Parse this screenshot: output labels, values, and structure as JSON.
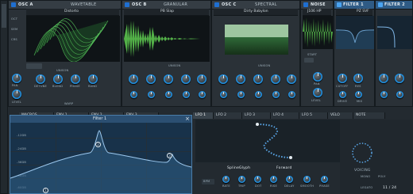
{
  "colors": {
    "accent": "#1f8fe0",
    "wave": "#6cd06a",
    "bg": "#1b2126",
    "curve": "#7fb6e6"
  },
  "left_strip": {
    "items": [
      "SUB",
      "ENV",
      "LFO",
      "",
      "",
      "",
      "FX"
    ]
  },
  "osc_a": {
    "title": "OSC A",
    "type": "WAVETABLE",
    "wavetable": "Distorto",
    "oct": "OCT",
    "sem": "SEM",
    "crs": "CRS",
    "fine": "FINE",
    "unison_label": "UNISON",
    "knobs": [
      "PAN",
      "LEVEL"
    ],
    "sub": [
      "DETUNE",
      "BLEND",
      "PHASE",
      "RAND",
      "WARP"
    ]
  },
  "osc_b": {
    "title": "OSC B",
    "type": "GRANULAR",
    "sample": "PB Slap",
    "unison_label": "UNISON"
  },
  "osc_c": {
    "title": "OSC C",
    "type": "SPECTRAL",
    "sample": "Dirty Babylon",
    "unison_label": "UNISON"
  },
  "noise": {
    "title": "NOISE",
    "sample": "J106 HP",
    "start": "START",
    "pan": "PAN",
    "level": "LEVEL"
  },
  "filter1": {
    "title": "FILTER 1",
    "type": "PZ SVF",
    "cutoff": "CUTOFF",
    "res": "RES",
    "drive": "DRIVE",
    "mix": "MIX"
  },
  "filter2": {
    "title": "FILTER 2"
  },
  "bottom_tabs": {
    "tabs": [
      "MACROS",
      "ENV 1",
      "ENV 2",
      "ENV 3",
      "LFO 1",
      "LFO 2",
      "LFO 3",
      "LFO 4",
      "LFO 5",
      "VELO",
      "NOTE"
    ]
  },
  "filter_editor": {
    "title": "Filter 1",
    "close": "×",
    "db_labels": [
      "-12dB",
      "-24dB",
      "-36dB",
      "-48dB",
      "-60dB"
    ],
    "points": [
      "1",
      "2",
      "3"
    ]
  },
  "lfo": {
    "shape": "SplineGlyph",
    "mode": "Forward",
    "rate_label": "RATE",
    "trip": "TRIP",
    "dot": "DOT",
    "rise": "RISE",
    "delay": "DELAY",
    "smooth": "SMOOTH",
    "phase": "PHASE",
    "off": "OFF",
    "sync": "BPM",
    "bar": "BAR"
  },
  "voicing": {
    "title": "VOICING",
    "mono": "MONO",
    "poly": "POLY",
    "legato": "LEGATO",
    "count": "11 / 24"
  }
}
